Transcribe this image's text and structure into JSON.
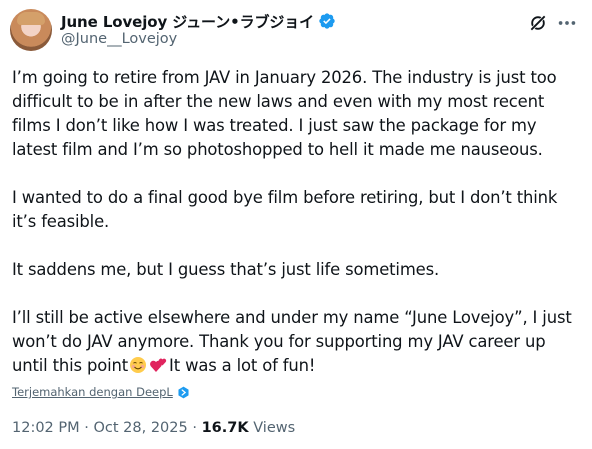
{
  "author": {
    "display_name": "June Lovejoy ジューン•ラブジョイ",
    "handle": "@June__Lovejoy"
  },
  "icons": {
    "verified": "verified-badge-icon",
    "grok": "grok-icon",
    "more": "more-options-icon",
    "deepl": "deepl-icon"
  },
  "colors": {
    "verified_blue": "#1d9bf0",
    "text_primary": "#0f1419",
    "text_secondary": "#536471"
  },
  "tweet": {
    "p1": "I’m going to retire from JAV in January 2026. The industry is just too difficult to be in after the new laws and even with my most recent films I don’t like how I was treated. I just saw the package for my latest film and I’m so photoshopped to hell it made me nauseous.",
    "p2": "I wanted to do a final good bye film before retiring, but I don’t think it’s feasible.",
    "p3": "It saddens me, but I guess that’s just life sometimes.",
    "p4_text": "I’ll still be active elsewhere and under my name “June Lovejoy”, I just won’t do JAV anymore. Thank you for supporting my JAV career up until this point",
    "p4_emoji_1": "☺️",
    "p4_emoji_2": "💕",
    "p4_tail": "It was a lot of fun!"
  },
  "translate_label": "Terjemahkan dengan DeepL",
  "meta": {
    "time": "12:02 PM",
    "date": "Oct 28, 2025",
    "separator": "·",
    "views_count": "16.7K",
    "views_label": "Views"
  }
}
